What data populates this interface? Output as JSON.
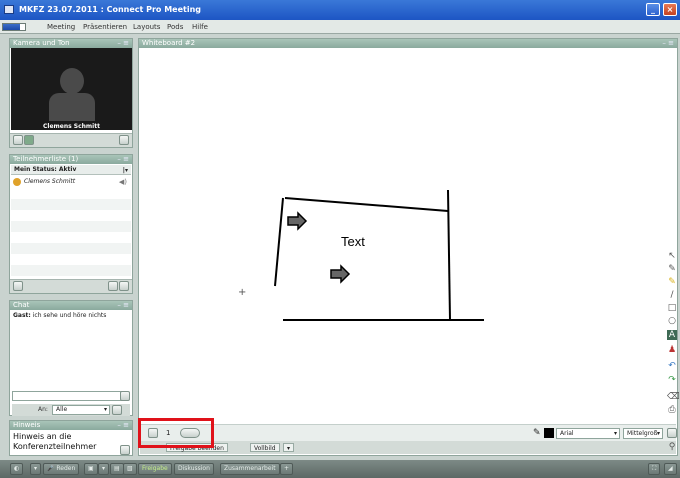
{
  "window": {
    "title": "MKFZ 23.07.2011 : Connect Pro Meeting",
    "minimize": "_",
    "close": "×"
  },
  "progress": {
    "fraction": 0.75
  },
  "menu": [
    "Meeting",
    "Präsentieren",
    "Layouts",
    "Pods",
    "Hilfe"
  ],
  "camera_pod": {
    "title": "Kamera und Ton",
    "person": "Clemens Schmitt"
  },
  "attendees_pod": {
    "title": "Teilnehmerliste (1)",
    "status": "Mein Status: Aktiv",
    "attendees": [
      {
        "name": "Clemens Schmitt"
      }
    ]
  },
  "chat_pod": {
    "title": "Chat",
    "messages": [
      {
        "sender": "Gast:",
        "text": "ich sehe und höre nichts"
      }
    ],
    "to_label": "An:",
    "to_value": "Alle"
  },
  "notes_pod": {
    "title": "Hinweis",
    "text_line1": "Hinweis an die",
    "text_line2": "Konferenzteilnehmer"
  },
  "whiteboard_pod": {
    "title": "Whiteboard #2",
    "canvas_text": "Text",
    "page_number": "1",
    "font_value": "Arial",
    "size_value": "Mittelgroß",
    "share_items": [
      "Freigabe beenden",
      "Vollbild",
      "▾"
    ]
  },
  "statusbar": {
    "speak": "Reden",
    "share": "Freigabe",
    "discussion": "Diskussion",
    "collab": "Zusammenarbeit",
    "add": "+"
  }
}
